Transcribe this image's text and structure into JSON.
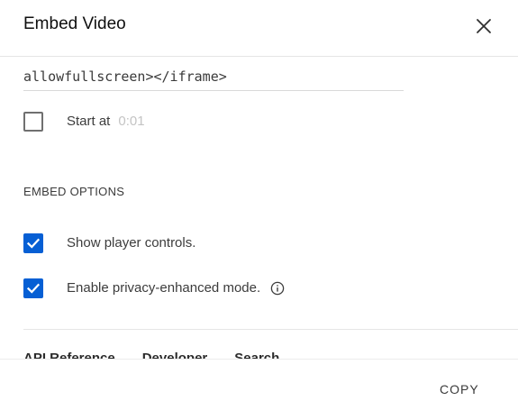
{
  "dialog": {
    "title": "Embed Video",
    "close_icon": "close-icon"
  },
  "embed_code": {
    "visible_text": "allowfullscreen></iframe>"
  },
  "start_at": {
    "label": "Start at",
    "time": "0:01",
    "checked": false
  },
  "embed_options": {
    "heading": "EMBED OPTIONS",
    "items": [
      {
        "label": "Show player controls.",
        "checked": true
      },
      {
        "label": "Enable privacy-enhanced mode.",
        "checked": true,
        "icon": "info-icon"
      }
    ]
  },
  "tabs": {
    "items": [
      "API Reference",
      "Developer",
      "Search"
    ]
  },
  "actions": {
    "copy_label": "COPY"
  },
  "colors": {
    "accent": "#065fd4",
    "checkbox_border": "#707070",
    "disabled_text": "#c4c4c4",
    "divider": "#e5e5e5"
  }
}
